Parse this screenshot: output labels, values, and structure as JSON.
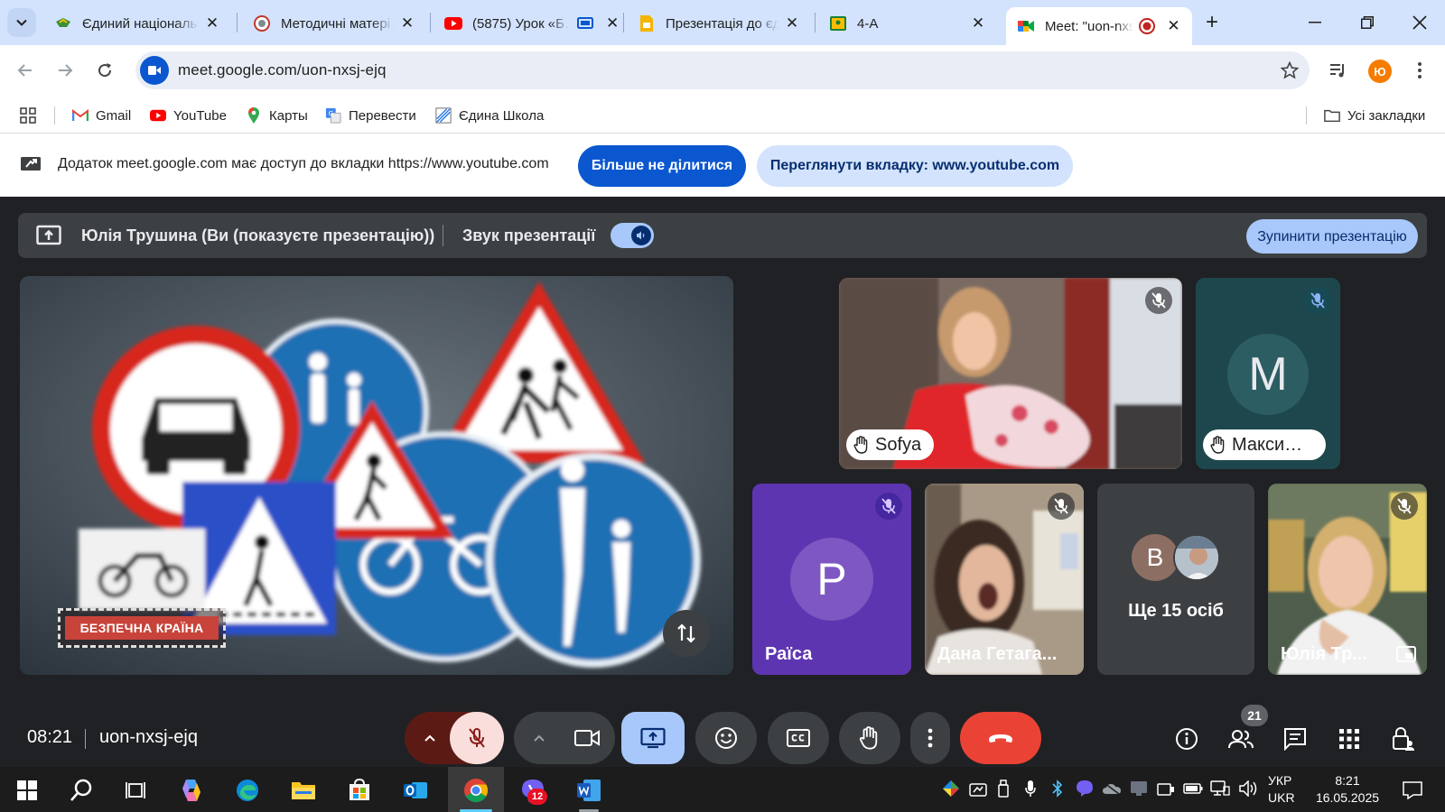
{
  "browser": {
    "tabs": [
      {
        "label": "Єдиний національ…",
        "active": false
      },
      {
        "label": "Методичні матері…",
        "active": false
      },
      {
        "label": "(5875) Урок «Б…",
        "active": false
      },
      {
        "label": "Презентація до єд…",
        "active": false
      },
      {
        "label": "4-А",
        "active": false
      },
      {
        "label": "Meet: \"uon-nxs…",
        "active": true
      }
    ],
    "url": "meet.google.com/uon-nxsj-ejq",
    "profile_initial": "Ю",
    "bookmarks": [
      {
        "label": "Gmail",
        "icon": "gmail-icon"
      },
      {
        "label": "YouTube",
        "icon": "youtube-icon"
      },
      {
        "label": "Карты",
        "icon": "maps-icon"
      },
      {
        "label": "Перевести",
        "icon": "translate-icon"
      },
      {
        "label": "Єдина Школа",
        "icon": "school-icon"
      }
    ],
    "all_bookmarks": "Усі закладки"
  },
  "infobar": {
    "text": "Додаток meet.google.com має доступ до вкладки https://www.youtube.com",
    "stop_sharing": "Більше не ділитися",
    "view_tab": "Переглянути вкладку: www.youtube.com"
  },
  "meet": {
    "presenter_text": "Юлія Трушина (Ви (показуєте презентацію))",
    "presentation_audio": "Звук презентації",
    "stop_presentation": "Зупинити презентацію",
    "presentation_caption": "БЕЗПЕЧНА КРАЇНА",
    "participants": [
      {
        "name": "Sofya",
        "hand_raised": true,
        "muted": true
      },
      {
        "name": "Макси…",
        "initial": "M",
        "hand_raised": true,
        "muted": true
      },
      {
        "name": "Раїса",
        "initial": "P",
        "muted": true
      },
      {
        "name": "Дана Гетага...",
        "muted": true
      },
      {
        "name": "Юлія Тр...",
        "muted": true
      }
    ],
    "others": {
      "label": "Ще 15 осіб",
      "initial": "B"
    },
    "time": "08:21",
    "meeting_code": "uon-nxsj-ejq",
    "participant_count": "21"
  },
  "taskbar": {
    "language_top": "УКР",
    "language_bottom": "UKR",
    "clock_time": "8:21",
    "clock_date": "16.05.2025",
    "viber_badge": "12"
  },
  "colors": {
    "tabstrip": "#d3e3fd",
    "accent": "#0b57d0",
    "meet_bg": "#202124",
    "hangup": "#ea4335",
    "light_blue": "#a8c7fa"
  }
}
